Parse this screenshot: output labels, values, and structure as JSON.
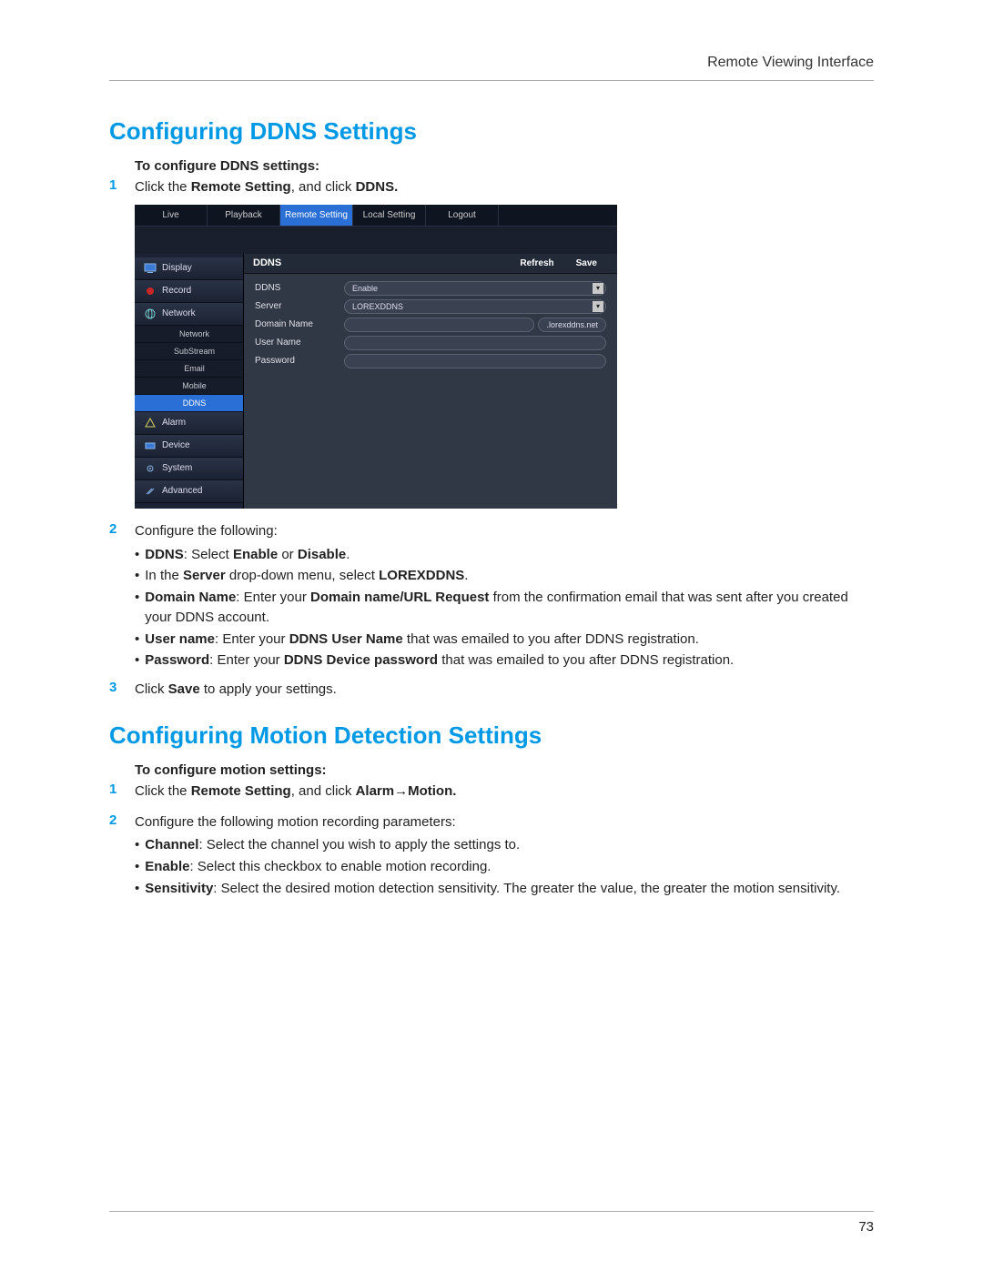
{
  "header": {
    "right": "Remote Viewing Interface"
  },
  "section1": {
    "heading": "Configuring DDNS Settings",
    "sub": "To configure DDNS settings:",
    "step1_num": "1",
    "step1_a": "Click the ",
    "step1_b": "Remote Setting",
    "step1_c": ", and click ",
    "step1_d": "DDNS.",
    "step2_num": "2",
    "step2": "Configure the following:",
    "b1_a": "DDNS",
    "b1_b": ": Select ",
    "b1_c": "Enable",
    "b1_d": " or ",
    "b1_e": "Disable",
    "b1_f": ".",
    "b2_a": "In the ",
    "b2_b": "Server",
    "b2_c": " drop-down menu, select ",
    "b2_d": "LOREXDDNS",
    "b2_e": ".",
    "b3_a": "Domain Name",
    "b3_b": ": Enter your ",
    "b3_c": "Domain name/URL Request",
    "b3_d": " from the confirmation email that was sent after you created your DDNS account.",
    "b4_a": "User name",
    "b4_b": ": Enter your ",
    "b4_c": "DDNS User Name",
    "b4_d": " that was emailed to you after DDNS registration.",
    "b5_a": "Password",
    "b5_b": ": Enter your ",
    "b5_c": "DDNS Device password",
    "b5_d": " that was emailed to you after DDNS registration.",
    "step3_num": "3",
    "step3_a": "Click ",
    "step3_b": "Save",
    "step3_c": " to apply your settings."
  },
  "section2": {
    "heading": "Configuring Motion Detection Settings",
    "sub": "To configure motion settings:",
    "step1_num": "1",
    "step1_a": "Click the ",
    "step1_b": "Remote Setting",
    "step1_c": ", and click ",
    "step1_d": "Alarm",
    "step1_e": "→",
    "step1_f": "Motion.",
    "step2_num": "2",
    "step2": "Configure the following motion recording parameters:",
    "b1_a": "Channel",
    "b1_b": ": Select the channel you wish to apply the settings to.",
    "b2_a": "Enable",
    "b2_b": ": Select this checkbox to enable motion recording.",
    "b3_a": "Sensitivity",
    "b3_b": ": Select the desired motion detection sensitivity. The greater the value, the greater the motion sensitivity."
  },
  "ui": {
    "tabs": {
      "live": "Live",
      "playback": "Playback",
      "remote": "Remote Setting",
      "local": "Local Setting",
      "logout": "Logout"
    },
    "side": {
      "display": "Display",
      "record": "Record",
      "network": "Network",
      "network_sub": {
        "network": "Network",
        "substream": "SubStream",
        "email": "Email",
        "mobile": "Mobile",
        "ddns": "DDNS"
      },
      "alarm": "Alarm",
      "device": "Device",
      "system": "System",
      "advanced": "Advanced"
    },
    "panel": {
      "title": "DDNS",
      "refresh": "Refresh",
      "save": "Save",
      "rows": {
        "ddns_lbl": "DDNS",
        "ddns_val": "Enable",
        "server_lbl": "Server",
        "server_val": "LOREXDDNS",
        "domain_lbl": "Domain Name",
        "domain_suffix": ".lorexddns.net",
        "user_lbl": "User Name",
        "pass_lbl": "Password"
      }
    }
  },
  "footer": {
    "page": "73"
  }
}
